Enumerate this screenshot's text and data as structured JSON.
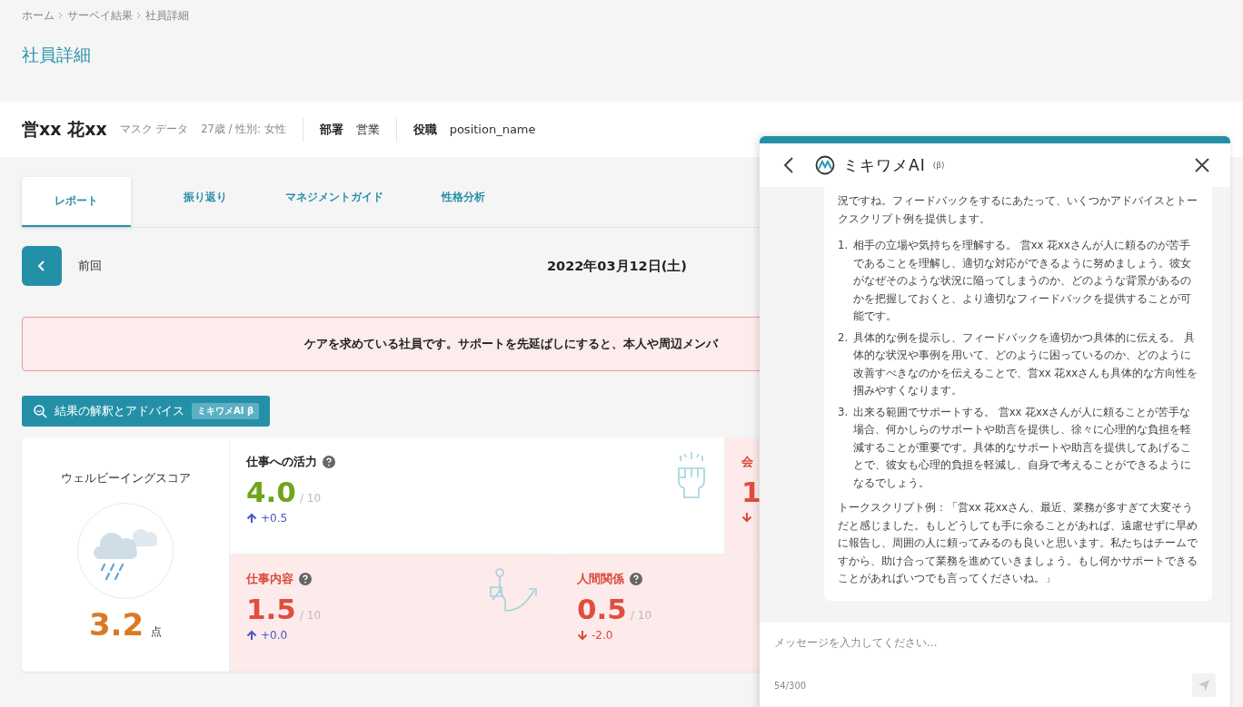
{
  "breadcrumb": [
    "ホーム",
    "サーベイ結果",
    "社員詳細"
  ],
  "page_title": "社員詳細",
  "employee": {
    "name": "営xx 花xx",
    "mask_label": "マスク データ",
    "age_gender": "27歳 / 性別: 女性",
    "department_label": "部署",
    "department": "営業",
    "position_label": "役職",
    "position": "position_name"
  },
  "tabs": [
    {
      "label": "レポート",
      "selected": true
    },
    {
      "label": "振り返り",
      "selected": false
    },
    {
      "label": "マネジメントガイド",
      "selected": false
    },
    {
      "label": "性格分析",
      "selected": false
    }
  ],
  "nav": {
    "previous_label": "前回",
    "date": "2022年03月12日(土)"
  },
  "alert": "ケアを求めている社員です。サポートを先延ばしにすると、本人や周辺メンバ",
  "ai_button": {
    "label": "結果の解釈とアドバイス",
    "badge": "ミキワメAI β"
  },
  "wellbeing": {
    "label": "ウェルビーイングスコア",
    "score": "3.2",
    "unit": "点"
  },
  "metric_rows": [
    [
      {
        "name": "仕事への活力",
        "score": "4.0",
        "max": "/ 10",
        "delta": "+0.5",
        "up": true,
        "alert": false
      },
      {
        "name": "会",
        "score": "1",
        "up": false,
        "alert": true
      }
    ],
    [
      {
        "name": "仕事内容",
        "score": "1.5",
        "max": "/ 10",
        "delta": "+0.0",
        "up": true,
        "alert": true
      },
      {
        "name": "人間関係",
        "score": "0.5",
        "max": "/ 10",
        "delta": "-2.0",
        "up": false,
        "alert": true
      }
    ]
  ],
  "chat": {
    "title": "ミキワメAI",
    "title_suffix": "(β)",
    "intro": "況ですね。フィードバックをするにあたって、いくつかアドバイスとトークスクリプト例を提供します。",
    "items": [
      {
        "number": "1.",
        "text": "相手の立場や気持ちを理解する。 営xx 花xxさんが人に頼るのが苦手であることを理解し、適切な対応ができるように努めましょう。彼女がなぜそのような状況に陥ってしまうのか、どのような背景があるのかを把握しておくと、より適切なフィードバックを提供することが可能です。"
      },
      {
        "number": "2.",
        "text": "具体的な例を提示し、フィードバックを適切かつ具体的に伝える。 具体的な状況や事例を用いて、どのように困っているのか、どのように改善すべきなのかを伝えることで、営xx 花xxさんも具体的な方向性を掴みやすくなります。"
      },
      {
        "number": "3.",
        "text": "出来る範囲でサポートする。 営xx 花xxさんが人に頼ることが苦手な場合、何かしらのサポートや助言を提供し、徐々に心理的な負担を軽減することが重要です。具体的なサポートや助言を提供してあげることで、彼女も心理的負担を軽減し、自身で考えることができるようになるでしょう。"
      }
    ],
    "closing": "トークスクリプト例：「営xx 花xxさん、最近、業務が多すぎて大変そうだと感じました。もしどうしても手に余ることがあれば、遠慮せずに早めに報告し、周囲の人に頼ってみるのも良いと思います。私たちはチームですから、助け合って業務を進めていきましょう。もし何かサポートできることがあればいつでも言ってくださいね。」",
    "input": {
      "placeholder": "メッセージを入力してください...",
      "counter": "54/300"
    }
  }
}
